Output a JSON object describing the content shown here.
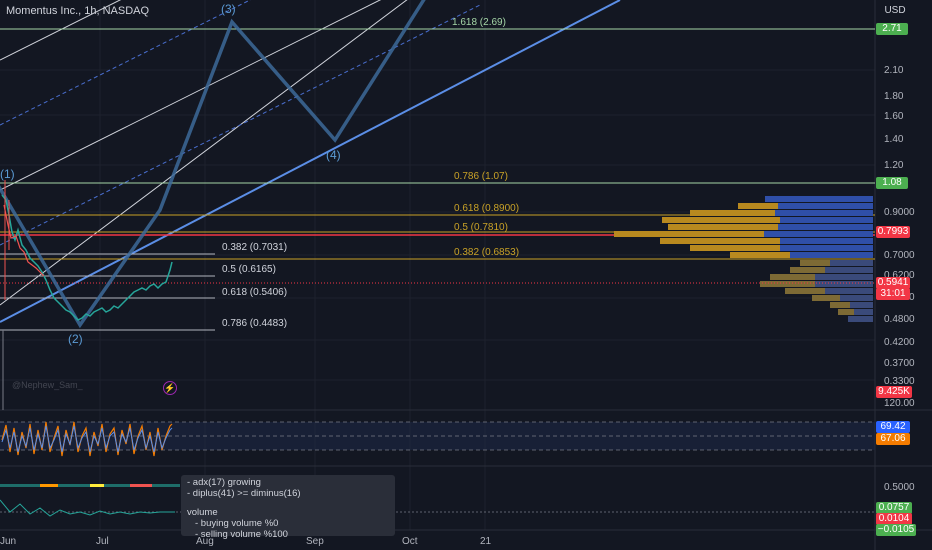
{
  "header": {
    "title": "Momentus Inc., 1h, NASDAQ",
    "currency": "USD"
  },
  "price_axis": {
    "labels": [
      "2.10",
      "1.80",
      "1.60",
      "1.40",
      "1.20",
      "0.9000",
      "0.7000",
      "0.6200",
      "0.5400",
      "0.4800",
      "0.4200",
      "0.3700",
      "0.3300",
      "120.00",
      "0.5000"
    ],
    "tags": [
      {
        "text": "2.71",
        "color": "#4caf50"
      },
      {
        "text": "1.08",
        "color": "#4caf50"
      },
      {
        "text": "0.7993",
        "color": "#f23645"
      },
      {
        "text": "0.5941",
        "color": "#f23645"
      },
      {
        "text": "31:01",
        "color": "#f23645"
      },
      {
        "text": "9.425K",
        "color": "#f23645"
      },
      {
        "text": "69.42",
        "color": "#2962ff"
      },
      {
        "text": "67.06",
        "color": "#f57c00"
      },
      {
        "text": "0.0757",
        "color": "#4caf50"
      },
      {
        "text": "0.0104",
        "color": "#f23645"
      },
      {
        "text": "−0.0105",
        "color": "#4caf50"
      }
    ]
  },
  "time_axis": [
    "Jun",
    "Jul",
    "Aug",
    "Sep",
    "Oct",
    "21"
  ],
  "fib_right": [
    "1.618 (2.69)",
    "0.786 (1.07)",
    "0.618 (0.8900)",
    "0.5 (0.7810)",
    "0.382 (0.6853)"
  ],
  "fib_left": [
    "0.382 (0.7031)",
    "0.5 (0.6165)",
    "0.618 (0.5406)",
    "0.786 (0.4483)"
  ],
  "waves": [
    "(1)",
    "(2)",
    "(3)",
    "(4)"
  ],
  "author": "@Nephew_Sam_",
  "tooltip": {
    "lines": [
      "- adx(17) growing",
      "- diplus(41) >= diminus(16)",
      "",
      "volume",
      "  - buying volume %0",
      "  - selling volume %100"
    ]
  },
  "colors": {
    "background": "#131722",
    "channel": "#4a90e2",
    "wave_path": "#3d6a99",
    "fib_gold": "#c9a227",
    "red_level": "#f23645",
    "green_level": "#4caf50"
  }
}
